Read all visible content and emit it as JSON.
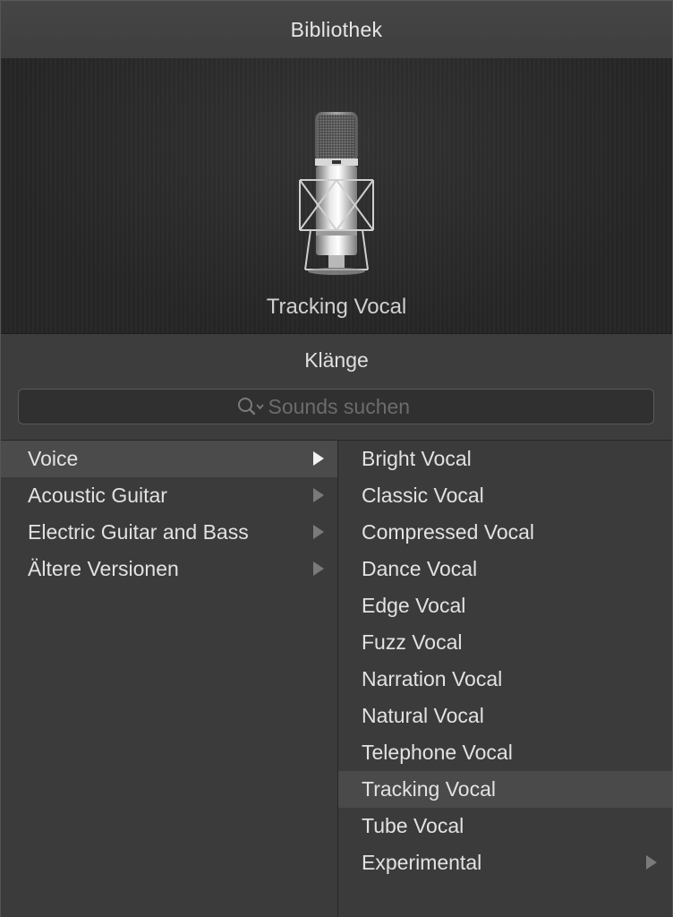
{
  "header": {
    "title": "Bibliothek"
  },
  "preview": {
    "name": "Tracking Vocal",
    "icon": "microphone-icon"
  },
  "sounds": {
    "title": "Klänge",
    "search_placeholder": "Sounds suchen",
    "search_icon": "search-icon"
  },
  "categories": [
    {
      "label": "Voice",
      "selected": true,
      "has_submenu": true
    },
    {
      "label": "Acoustic Guitar",
      "selected": false,
      "has_submenu": true
    },
    {
      "label": "Electric Guitar and Bass",
      "selected": false,
      "has_submenu": true
    },
    {
      "label": "Ältere Versionen",
      "selected": false,
      "has_submenu": true
    }
  ],
  "patches": [
    {
      "label": "Bright Vocal"
    },
    {
      "label": "Classic Vocal"
    },
    {
      "label": "Compressed Vocal"
    },
    {
      "label": "Dance Vocal"
    },
    {
      "label": "Edge Vocal"
    },
    {
      "label": "Fuzz Vocal"
    },
    {
      "label": "Narration Vocal"
    },
    {
      "label": "Natural Vocal"
    },
    {
      "label": "Telephone Vocal"
    },
    {
      "label": "Tracking Vocal",
      "selected": true
    },
    {
      "label": "Tube Vocal"
    },
    {
      "label": "Experimental",
      "has_submenu": true
    }
  ],
  "colors": {
    "panel_bg": "#3b3b3b",
    "selected_bg": "#4b4b4b",
    "text": "#e2e2e2",
    "arrow": "#7a7a7a"
  }
}
